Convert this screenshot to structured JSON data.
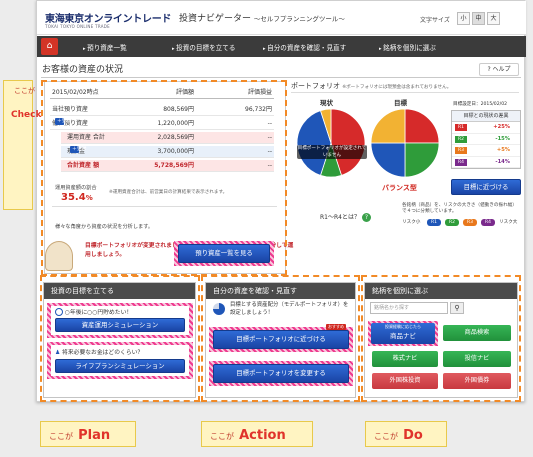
{
  "header": {
    "logo": "東海東京オンライントレード",
    "logo_sub": "TOKAI TOKYO ONLINE TRADE",
    "app_title": "投資ナビゲーター",
    "app_subtitle": "～セルフプランニングツール～",
    "font_size_label": "文字サイズ",
    "font_sizes": [
      "小",
      "中",
      "大"
    ]
  },
  "nav": {
    "items": [
      "預り資産一覧",
      "投資の目標を立てる",
      "自分の資産を確認・見直す",
      "銘柄を個別に選ぶ"
    ]
  },
  "page": {
    "title": "お客様の資産の状況",
    "help_label": "ヘルプ"
  },
  "assets": {
    "date": "2015/02/02時点",
    "col_value": "評価額",
    "col_diff": "評価損益",
    "rows": [
      {
        "label": "当社預り資産",
        "value": "808,569円",
        "diff": "96,732円",
        "add": ""
      },
      {
        "label": "他社預り資産",
        "value": "1,220,000円",
        "diff": "--",
        "add": "登録"
      },
      {
        "label": "運用資産 合計",
        "value": "2,028,569円",
        "diff": "--",
        "add": ""
      },
      {
        "label": "現預金",
        "value": "3,700,000円",
        "diff": "--",
        "add": "登録"
      },
      {
        "label": "合計資産 額",
        "value": "5,728,569円",
        "diff": "--",
        "add": ""
      }
    ],
    "ratio_label": "運用資産額の割合",
    "ratio_value": "35.4",
    "ratio_unit": "%",
    "ratio_note": "※運用資産合計は、前営業日の計算結果で表示されます。",
    "note": "様々な角度から資産の状況を分析します。",
    "button": "預り資産一覧を見る"
  },
  "portfolio": {
    "title": "ポートフォリオ",
    "title_note": "※ポートフォリオには現預金は含まれておりません。",
    "current_label": "現状",
    "target_label": "目標",
    "overlay_text": "目標ポートフォリオが設定されていません",
    "balance_label": "バランス型",
    "date_label": "目標設定日：2015/02/02",
    "diff_header": "目標との現状の差異",
    "diffs": [
      {
        "k": "R1",
        "v": "+25%",
        "color": "#d62a2a"
      },
      {
        "k": "R2",
        "v": "-15%",
        "color": "#2f9c3a"
      },
      {
        "k": "R3",
        "v": "+5%",
        "color": "#e8781c"
      },
      {
        "k": "R4",
        "v": "-14%",
        "color": "#7a2a8c"
      }
    ],
    "approach_button": "目標に近づける",
    "r_question": "R1～R4とは？",
    "r_desc": "各銘柄（商品）を、リスクの大きさ（値動きの振れ幅）で４つに分類しています。",
    "risk_small": "リスク小",
    "risk_large": "リスク大",
    "r_pills": [
      "R1",
      "R2",
      "R3",
      "R4"
    ],
    "current_pie": [
      {
        "name": "R1",
        "value": 45,
        "color": "#d62a2a"
      },
      {
        "name": "R2",
        "value": 10,
        "color": "#2f9c3a"
      },
      {
        "name": "R3",
        "value": 40,
        "color": "#1f56b8"
      },
      {
        "name": "R4",
        "value": 5,
        "color": "#f2b233"
      }
    ],
    "target_pie": [
      {
        "name": "R1",
        "value": 25,
        "color": "#d62a2a"
      },
      {
        "name": "R2",
        "value": 25,
        "color": "#2f9c3a"
      },
      {
        "name": "R3",
        "value": 25,
        "color": "#1f56b8"
      },
      {
        "name": "R4",
        "value": 25,
        "color": "#f2b233"
      }
    ]
  },
  "message": "目標ポートフォリオが変更されました。目標に近づくように、資産を配分して運用しましょう。",
  "plan": {
    "header": "投資の目標を立てる",
    "item1_text": "○年後に○○円貯めたい！",
    "item1_button": "資産運用シミュレーション",
    "item2_text": "将来必要なお金はどのくらい？",
    "item2_button": "ライフプランシミュレーション"
  },
  "action": {
    "header": "自分の資産を確認・見直す",
    "text": "目標とする資産配分（モデルポートフォリオ）を設定しましょう！",
    "button1": "目標ポートフォリオに近づける",
    "button2": "目標ポートフォリオを変更する",
    "badge": "おすすめ"
  },
  "do": {
    "header": "銘柄を個別に選ぶ",
    "search_placeholder": "銘柄名から探す",
    "nav_button_note": "投資経験に応じたら",
    "nav_button": "商品ナビ",
    "buttons": [
      "商品検索",
      "株式ナビ",
      "投信ナビ",
      "外国株投資",
      "外国債券"
    ]
  },
  "side_labels": {
    "check_prefix": "ここが",
    "check_word": "Check",
    "plan_prefix": "ここが",
    "plan_word": "Plan",
    "action_prefix": "ここが",
    "action_word": "Action",
    "do_prefix": "ここが",
    "do_word": "Do"
  }
}
